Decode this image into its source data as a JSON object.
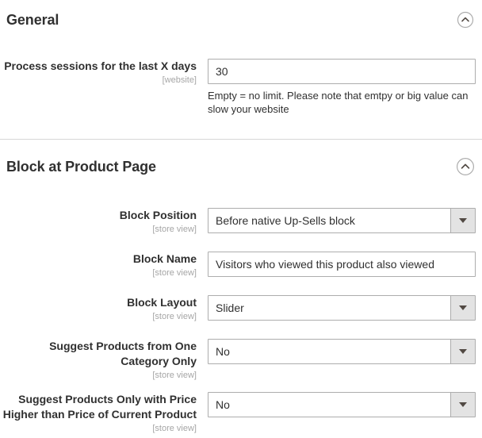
{
  "sections": [
    {
      "title": "General",
      "collapse_icon": "chevron-up-circle-icon",
      "fields": [
        {
          "label": "Process sessions for the last X days",
          "scope": "[website]",
          "type": "text",
          "value": "30",
          "note": "Empty = no limit. Please note that emtpy or big value can slow your website"
        }
      ]
    },
    {
      "title": "Block at Product Page",
      "collapse_icon": "chevron-up-circle-icon",
      "fields": [
        {
          "label": "Block Position",
          "scope": "[store view]",
          "type": "select",
          "value": "Before native Up-Sells block"
        },
        {
          "label": "Block Name",
          "scope": "[store view]",
          "type": "text",
          "value": "Visitors who viewed this product also viewed"
        },
        {
          "label": "Block Layout",
          "scope": "[store view]",
          "type": "select",
          "value": "Slider"
        },
        {
          "label": "Suggest Products from One Category Only",
          "scope": "[store view]",
          "type": "select",
          "value": "No"
        },
        {
          "label": "Suggest Products Only with Price Higher than Price of Current Product",
          "scope": "[store view]",
          "type": "select",
          "value": "No"
        }
      ]
    }
  ],
  "colors": {
    "text": "#303030",
    "scope": "#a6a6a6",
    "border": "#adadad",
    "divider": "#d6d6d6",
    "select_button": "#e3e3e3",
    "caret": "#514943"
  }
}
